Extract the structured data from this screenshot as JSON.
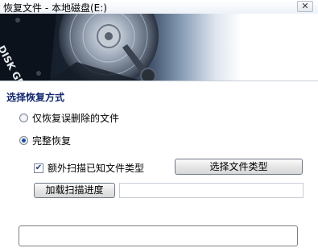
{
  "window": {
    "title": "恢复文件 - 本地磁盘(E:)",
    "close_glyph": "✕"
  },
  "banner": {
    "logo_text": "DISK GENIUS"
  },
  "recovery": {
    "section_title": "选择恢复方式",
    "options": [
      {
        "label": "仅恢复误删除的文件",
        "selected": false
      },
      {
        "label": "完整恢复",
        "selected": true
      }
    ],
    "extra_scan_label": "额外扫描已知文件类型",
    "extra_scan_checked": true,
    "checkbox_mark": "✔",
    "select_file_type_button": "选择文件类型",
    "load_progress_button": "加载扫描进度",
    "progress_path_value": ""
  }
}
